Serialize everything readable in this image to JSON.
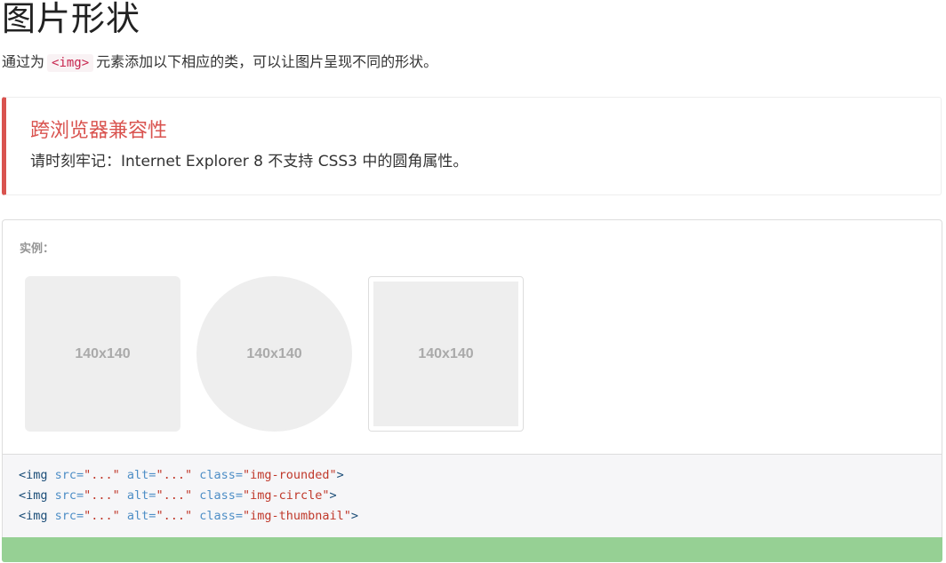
{
  "header": {
    "title": "图片形状",
    "intro_before": "通过为",
    "intro_code": "<img>",
    "intro_after": "元素添加以下相应的类，可以让图片呈现不同的形状。"
  },
  "callout": {
    "title": "跨浏览器兼容性",
    "text": "请时刻牢记：Internet Explorer 8 不支持 CSS3 中的圆角属性。",
    "accent_color": "#d9534f"
  },
  "example": {
    "label": "实例：",
    "images": [
      {
        "shape": "rounded",
        "placeholder": "140x140"
      },
      {
        "shape": "circle",
        "placeholder": "140x140"
      },
      {
        "shape": "thumbnail",
        "placeholder": "140x140"
      }
    ]
  },
  "code": {
    "lines": [
      {
        "tag": "<img",
        "src_attr": " src=",
        "src_val": "\"...\"",
        "alt_attr": " alt=",
        "alt_val": "\"...\"",
        "class_attr": " class=",
        "class_val": "\"img-rounded\"",
        "close": ">"
      },
      {
        "tag": "<img",
        "src_attr": " src=",
        "src_val": "\"...\"",
        "alt_attr": " alt=",
        "alt_val": "\"...\"",
        "class_attr": " class=",
        "class_val": "\"img-circle\"",
        "close": ">"
      },
      {
        "tag": "<img",
        "src_attr": " src=",
        "src_val": "\"...\"",
        "alt_attr": " alt=",
        "alt_val": "\"...\"",
        "class_attr": " class=",
        "class_val": "\"img-thumbnail\"",
        "close": ">"
      }
    ]
  },
  "colors": {
    "green_bar": "#96d094",
    "placeholder_bg": "#eeeeee",
    "placeholder_text": "#aaaaaa"
  }
}
